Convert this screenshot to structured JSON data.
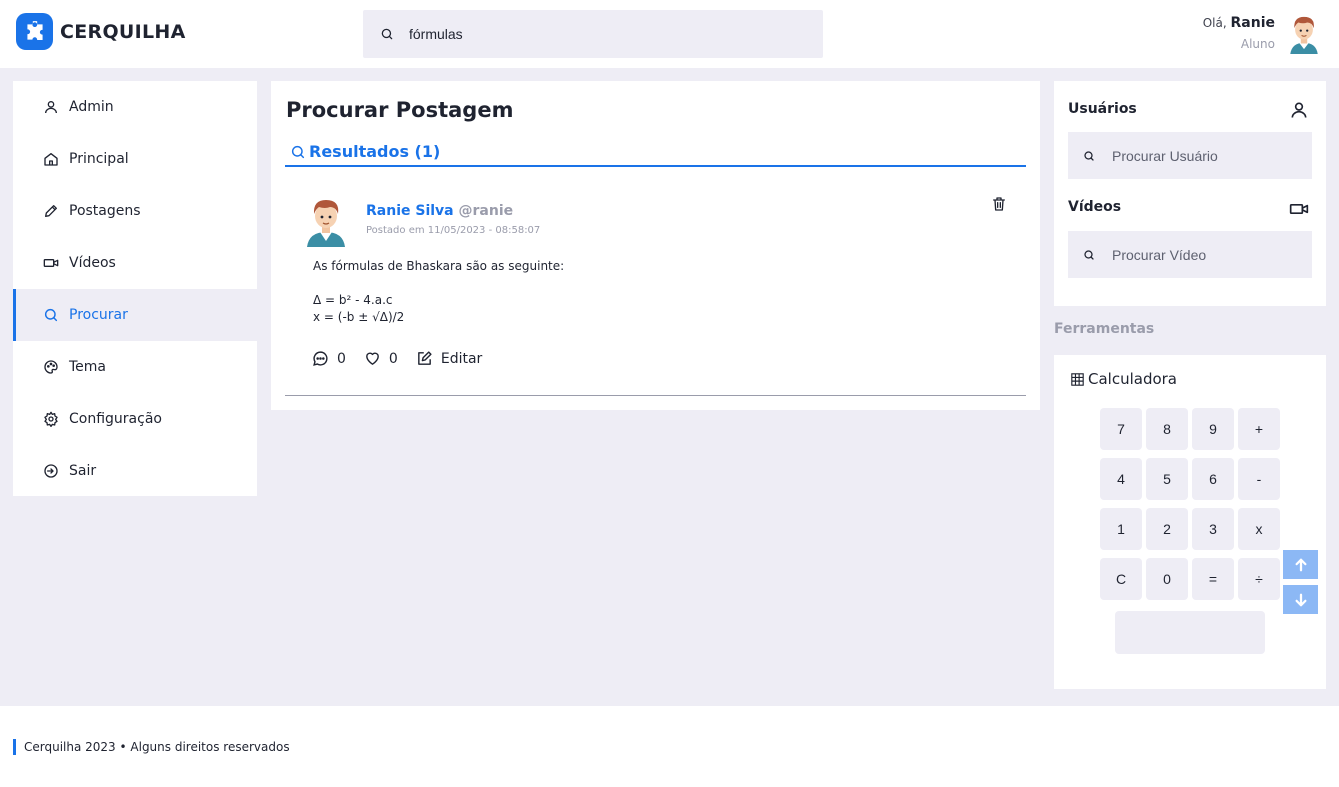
{
  "brand": {
    "name": "CERQUILHA",
    "color": "#1a73e8"
  },
  "top_search": {
    "value": "fórmulas",
    "icon": "search-icon"
  },
  "user": {
    "greeting": "Olá,",
    "name": "Ranie",
    "role": "Aluno"
  },
  "sidebar": {
    "items": [
      {
        "label": "Admin",
        "icon": "user-icon"
      },
      {
        "label": "Principal",
        "icon": "home-icon"
      },
      {
        "label": "Postagens",
        "icon": "pencil-icon"
      },
      {
        "label": "Vídeos",
        "icon": "video-icon"
      },
      {
        "label": "Procurar",
        "icon": "search-icon",
        "active": true
      },
      {
        "label": "Tema",
        "icon": "palette-icon"
      },
      {
        "label": "Configuração",
        "icon": "gear-icon"
      },
      {
        "label": "Sair",
        "icon": "logout-icon"
      }
    ]
  },
  "main": {
    "title": "Procurar Postagem",
    "results_label": "Resultados (1)",
    "post": {
      "author": "Ranie Silva",
      "handle": "@ranie",
      "date": "Postado em 11/05/2023 - 08:58:07",
      "body": [
        "As fórmulas de Bhaskara são as seguinte:",
        "",
        "Δ = b² - 4.a.c",
        "x = (-b ± √Δ)/2"
      ],
      "comments": "0",
      "likes": "0",
      "edit_label": "Editar"
    }
  },
  "right": {
    "users_title": "Usuários",
    "users_placeholder": "Procurar Usuário",
    "videos_title": "Vídeos",
    "videos_placeholder": "Procurar Vídeo",
    "tools_title": "Ferramentas",
    "calculator_title": "Calculadora",
    "calculator_keys": [
      "7",
      "8",
      "9",
      "+",
      "4",
      "5",
      "6",
      "-",
      "1",
      "2",
      "3",
      "x",
      "C",
      "0",
      "=",
      "÷"
    ],
    "calculator_display": ""
  },
  "footer": {
    "text": "Cerquilha 2023 • Alguns direitos reservados"
  }
}
